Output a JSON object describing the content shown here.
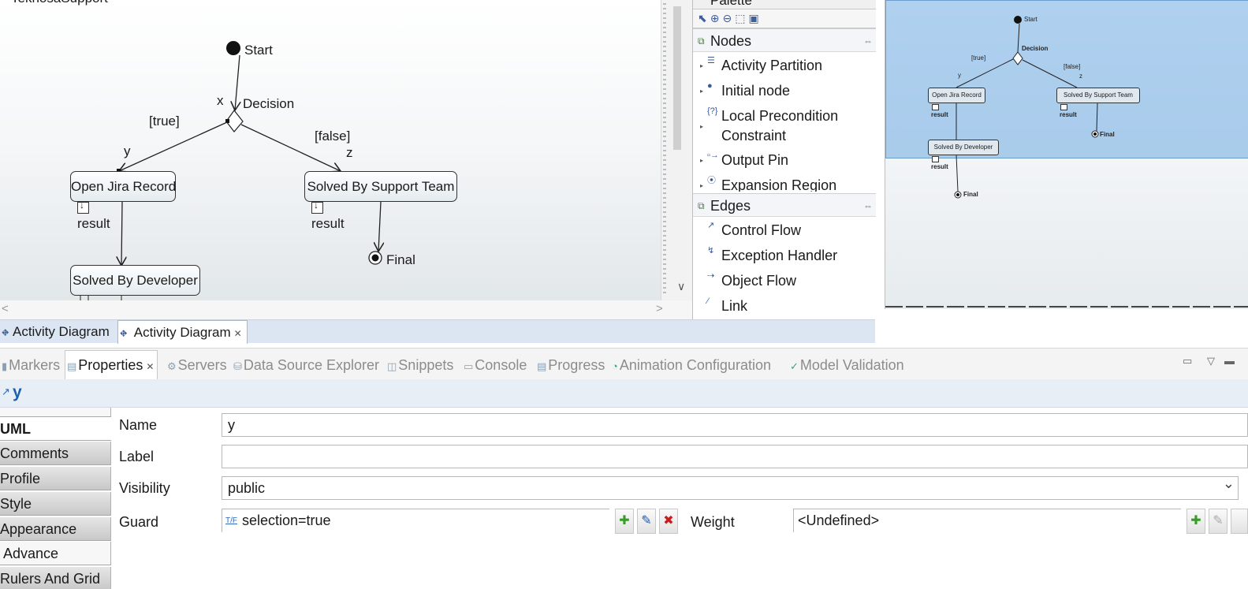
{
  "diagram": {
    "top_label": "TeknosaSupport",
    "start": "Start",
    "decision": "Decision",
    "x": "x",
    "y": "y",
    "z": "z",
    "true_guard": "[true]",
    "false_guard": "[false]",
    "open_jira": "Open Jira Record",
    "solved_support": "Solved By Support Team",
    "solved_developer": "Solved By Developer",
    "result1": "result",
    "result2": "result",
    "final": "Final"
  },
  "editor_tabs": [
    "Activity Diagram",
    "Activity Diagram"
  ],
  "palette": {
    "title": "Palette",
    "nodes_drawer": "Nodes",
    "nodes": [
      "Activity Partition",
      "Initial node",
      "Local Precondition",
      "Constraint",
      "Output Pin",
      "Expansion Region"
    ],
    "edges_drawer": "Edges",
    "edges": [
      "Control Flow",
      "Exception Handler",
      "Object Flow",
      "Link"
    ]
  },
  "overview": {
    "start": "Start",
    "decision": "Decision",
    "true_guard": "[true]",
    "false_guard": "[false]",
    "y": "y",
    "z": "z",
    "open_jira": "Open Jira Record",
    "solved_support": "Solved By Support Team",
    "solved_developer": "Solved By Developer",
    "result": "result",
    "final": "Final"
  },
  "views": {
    "tabs": [
      "Markers",
      "Properties",
      "Servers",
      "Data Source Explorer",
      "Snippets",
      "Console",
      "Progress",
      "Animation Configuration",
      "Model Validation"
    ]
  },
  "properties": {
    "title": "y",
    "tabs": [
      "UML",
      "Comments",
      "Profile",
      "Style",
      "Appearance",
      "Advance",
      "Rulers And Grid"
    ],
    "name_label": "Name",
    "name_value": "y",
    "label_label": "Label",
    "label_value": "",
    "visibility_label": "Visibility",
    "visibility_value": "public",
    "guard_label": "Guard",
    "guard_icon": "T/F",
    "guard_value": "selection=true",
    "weight_label": "Weight",
    "weight_value": "<Undefined>"
  }
}
